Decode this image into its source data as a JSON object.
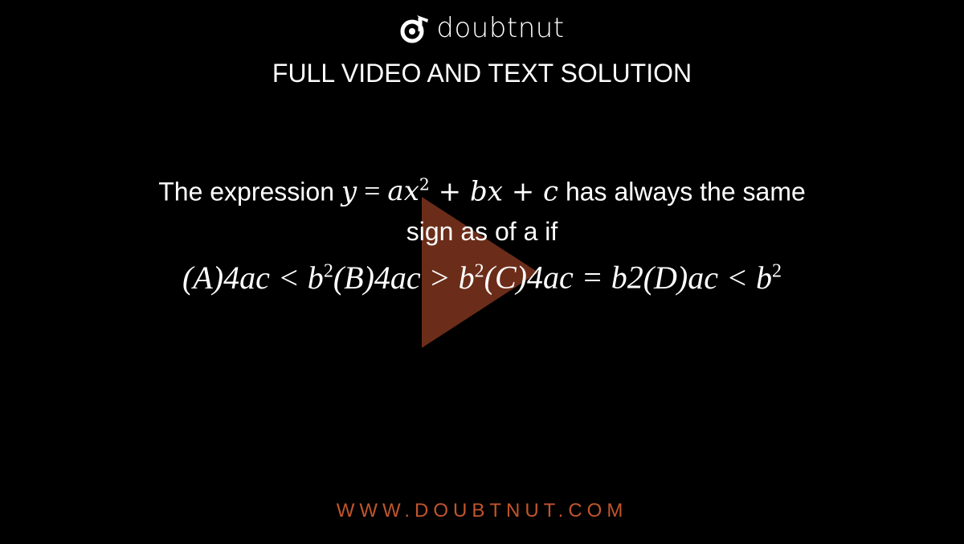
{
  "brand": {
    "name": "doubtnut",
    "logo_icon": "doubtnut-logo-icon"
  },
  "headline": "FULL VIDEO AND TEXT SOLUTION",
  "question": {
    "text_before": "The expression ",
    "math_expr_y": "y",
    "math_eq": " = ",
    "math_ax": "ax",
    "math_sq": "2",
    "math_rest": " + bx + c",
    "text_after": " has always the same",
    "line2": "sign as of a if",
    "options": [
      {
        "label": "(A)",
        "expr": "4ac < b",
        "sup": "2"
      },
      {
        "label": "(B)",
        "expr": "4ac > b",
        "sup": "2"
      },
      {
        "label": "(C)",
        "expr": "4ac = b2",
        "sup": ""
      },
      {
        "label": "(D)",
        "expr": "ac < b",
        "sup": "2"
      }
    ]
  },
  "play_button": {
    "icon": "play-icon",
    "color": "#7a331c"
  },
  "footer": "WWW.DOUBTNUT.COM",
  "colors": {
    "background": "#000000",
    "accent": "#c1552c"
  }
}
